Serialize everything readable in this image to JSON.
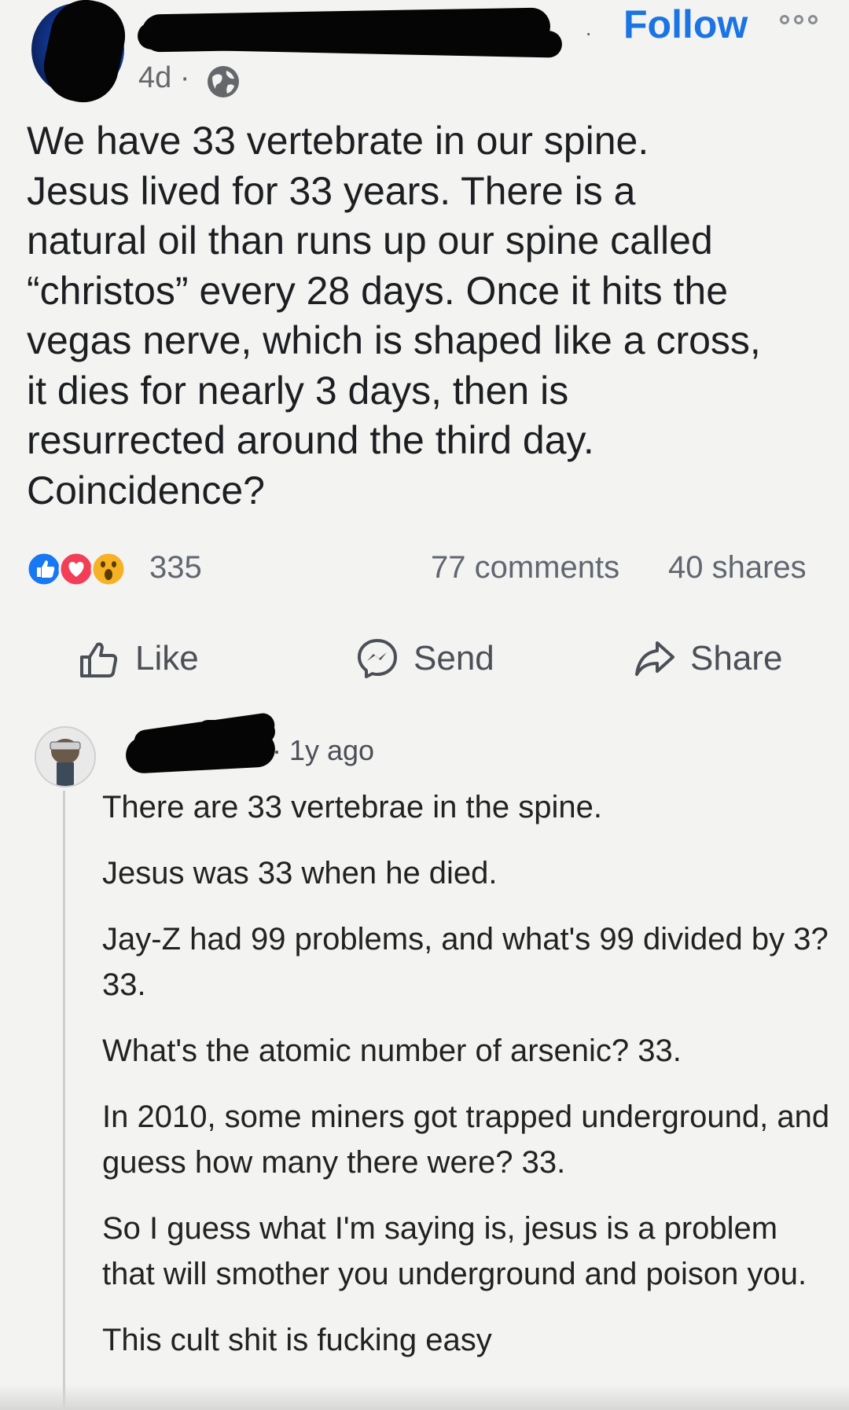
{
  "header": {
    "separator": "·",
    "follow_label": "Follow",
    "time": "4d ·",
    "icons": [
      "globe-icon",
      "more-options-icon"
    ]
  },
  "post": {
    "lines": [
      "We have 33 vertebrate in our spine.",
      "Jesus lived for 33 years.  There is a",
      "natural oil than runs up our spine called",
      "“christos” every 28 days.  Once it hits the",
      "vegas nerve, which is shaped like a cross,",
      "it dies for nearly 3 days, then is",
      "resurrected around the third day.",
      "Coincidence?"
    ]
  },
  "stats": {
    "reactions": "335",
    "comments": "77 comments",
    "shares": "40 shares",
    "reaction_icons": [
      "like-reaction-icon",
      "love-reaction-icon",
      "wow-reaction-icon"
    ]
  },
  "actions": {
    "like": "Like",
    "send": "Send",
    "share": "Share"
  },
  "comment": {
    "time": "· 1y ago",
    "paragraphs": [
      "There are 33 vertebrae in the spine.",
      "Jesus was 33 when he died.",
      "Jay-Z had 99 problems, and what's 99 divided by 3? 33.",
      "What's the atomic number of arsenic? 33.",
      "In 2010, some miners got trapped underground, and guess how many there were? 33.",
      "So I guess what I'm saying is, jesus is a problem that will smother you underground and poison you.",
      "This cult shit is fucking easy"
    ]
  },
  "colors": {
    "accent": "#1b74e4",
    "text": "#1c1e21",
    "muted": "#65676b",
    "background": "#f3f3f1",
    "like": "#1877f2",
    "love": "#f33e58",
    "wow": "#f7b125"
  }
}
